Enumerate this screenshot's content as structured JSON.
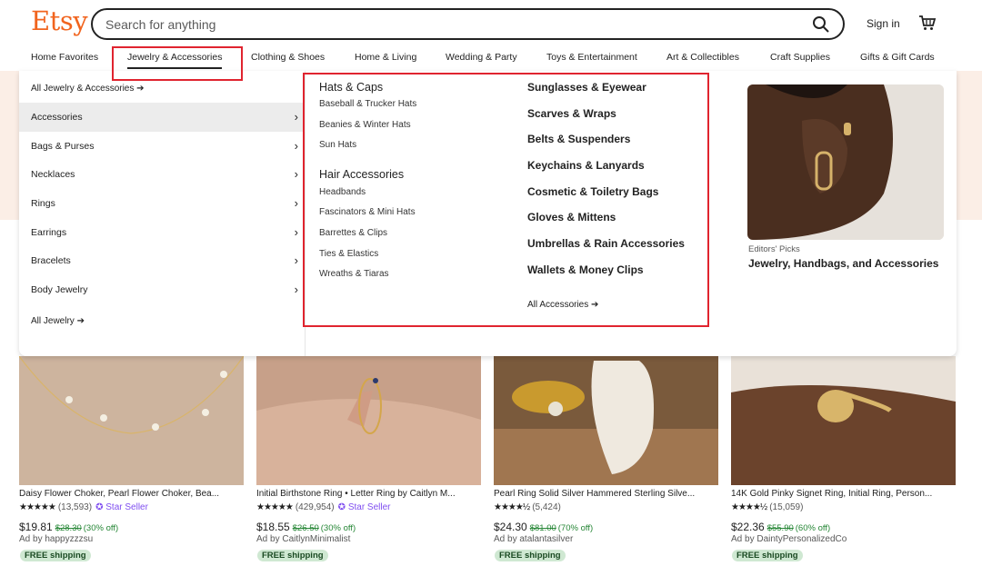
{
  "header": {
    "logo": "Etsy",
    "search_placeholder": "Search for anything",
    "signin": "Sign in"
  },
  "nav": [
    "Home Favorites",
    "Jewelry & Accessories",
    "Clothing & Shoes",
    "Home & Living",
    "Wedding & Party",
    "Toys & Entertainment",
    "Art & Collectibles",
    "Craft Supplies",
    "Gifts & Gift Cards"
  ],
  "menu": {
    "all_top": "All Jewelry & Accessories",
    "left_items": [
      "Accessories",
      "Bags & Purses",
      "Necklaces",
      "Rings",
      "Earrings",
      "Bracelets",
      "Body Jewelry"
    ],
    "all_bottom": "All Jewelry",
    "hats_heading": "Hats & Caps",
    "hats": [
      "Baseball & Trucker Hats",
      "Beanies & Winter Hats",
      "Sun Hats"
    ],
    "hair_heading": "Hair Accessories",
    "hair": [
      "Headbands",
      "Fascinators & Mini Hats",
      "Barrettes & Clips",
      "Ties & Elastics",
      "Wreaths & Tiaras"
    ],
    "right_items": [
      "Sunglasses & Eyewear",
      "Scarves & Wraps",
      "Belts & Suspenders",
      "Keychains & Lanyards",
      "Cosmetic & Toiletry Bags",
      "Gloves & Mittens",
      "Umbrellas & Rain Accessories",
      "Wallets & Money Clips"
    ],
    "all_accessories": "All Accessories",
    "editor_caption": "Editors' Picks",
    "editor_title": "Jewelry, Handbags, and Accessories"
  },
  "products": [
    {
      "title": "Daisy Flower Choker, Pearl Flower Choker, Bea...",
      "stars": "★★★★★",
      "count": "(13,593)",
      "star_seller": "Star Seller",
      "price": "$19.81",
      "orig": "$28.30",
      "off": "(30% off)",
      "ad": "Ad by happyzzzsu",
      "ship": "FREE shipping"
    },
    {
      "title": "Initial Birthstone Ring • Letter Ring by Caitlyn M...",
      "stars": "★★★★★",
      "count": "(429,954)",
      "star_seller": "Star Seller",
      "price": "$18.55",
      "orig": "$26.50",
      "off": "(30% off)",
      "ad": "Ad by CaitlynMinimalist",
      "ship": "FREE shipping"
    },
    {
      "title": "Pearl Ring Solid Silver Hammered Sterling Silve...",
      "stars": "★★★★½",
      "count": "(5,424)",
      "star_seller": "",
      "price": "$24.30",
      "orig": "$81.00",
      "off": "(70% off)",
      "ad": "Ad by atalantasilver",
      "ship": "FREE shipping"
    },
    {
      "title": "14K Gold Pinky Signet Ring, Initial Ring, Person...",
      "stars": "★★★★½",
      "count": "(15,059)",
      "star_seller": "",
      "price": "$22.36",
      "orig": "$55.90",
      "off": "(60% off)",
      "ad": "Ad by DaintyPersonalizedCo",
      "ship": "FREE shipping"
    }
  ]
}
